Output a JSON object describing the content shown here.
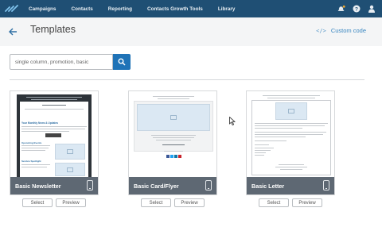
{
  "nav": {
    "items": [
      "Campaigns",
      "Contacts",
      "Reporting",
      "Contacts Growth Tools",
      "Library"
    ],
    "icons": [
      "logo-icon",
      "notifications-icon",
      "help-icon",
      "user-icon"
    ],
    "background": "#1f4f74"
  },
  "header": {
    "title": "Templates",
    "custom_code_label": "Custom code",
    "accent": "#3a87c1"
  },
  "search": {
    "value": "single column, promotion, basic",
    "button_color": "#1f73b7"
  },
  "templates": [
    {
      "name": "Basic Newsletter",
      "select_label": "Select",
      "preview_label": "Preview"
    },
    {
      "name": "Basic Card/Flyer",
      "select_label": "Select",
      "preview_label": "Preview"
    },
    {
      "name": "Basic Letter",
      "select_label": "Select",
      "preview_label": "Preview"
    }
  ],
  "newsletter_preview": {
    "heading": "Your Monthly News & Updates",
    "section_1": "Upcoming Events",
    "section_2": "Service Spotlight"
  }
}
